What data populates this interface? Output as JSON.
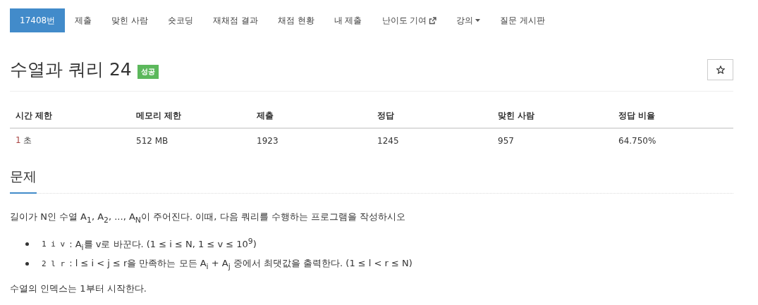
{
  "nav": [
    {
      "label": "17408번",
      "selected": true,
      "kind": "plain"
    },
    {
      "label": "제출",
      "selected": false,
      "kind": "plain"
    },
    {
      "label": "맞힌 사람",
      "selected": false,
      "kind": "plain"
    },
    {
      "label": "숏코딩",
      "selected": false,
      "kind": "plain"
    },
    {
      "label": "재채점 결과",
      "selected": false,
      "kind": "plain"
    },
    {
      "label": "채점 현황",
      "selected": false,
      "kind": "plain"
    },
    {
      "label": "내 제출",
      "selected": false,
      "kind": "plain"
    },
    {
      "label": "난이도 기여",
      "selected": false,
      "kind": "external"
    },
    {
      "label": "강의",
      "selected": false,
      "kind": "dropdown"
    },
    {
      "label": "질문 게시판",
      "selected": false,
      "kind": "plain"
    }
  ],
  "title": "수열과 쿼리 24",
  "result_badge": "성공",
  "starred": false,
  "stats": {
    "columns": [
      "시간 제한",
      "메모리 제한",
      "제출",
      "정답",
      "맞힌 사람",
      "정답 비율"
    ],
    "time_limit": {
      "value": "1",
      "unit": "초"
    },
    "values": [
      "512 MB",
      "1923",
      "1245",
      "957",
      "64.750%"
    ]
  },
  "section_heading": "문제",
  "intro": "길이가 N인 수열 A$_{1}$, A$_{2}$, ..., A$_{N}$이 주어진다. 이때, 다음 쿼리를 수행하는 프로그램을 작성하시오",
  "queries": [
    {
      "code": "1 i v",
      "text": ": A$_{i}$를 v로 바꾼다. (1 ≤ i ≤ N, 1 ≤ v ≤ 10$^{9}$)"
    },
    {
      "code": "2 l r",
      "text": ": l ≤ i < j ≤ r을 만족하는 모든 A$_{i}$ + A$_{j}$ 중에서 최댓값을 출력한다. (1 ≤ l < r ≤ N)"
    }
  ],
  "note": "수열의 인덱스는 1부터 시작한다."
}
